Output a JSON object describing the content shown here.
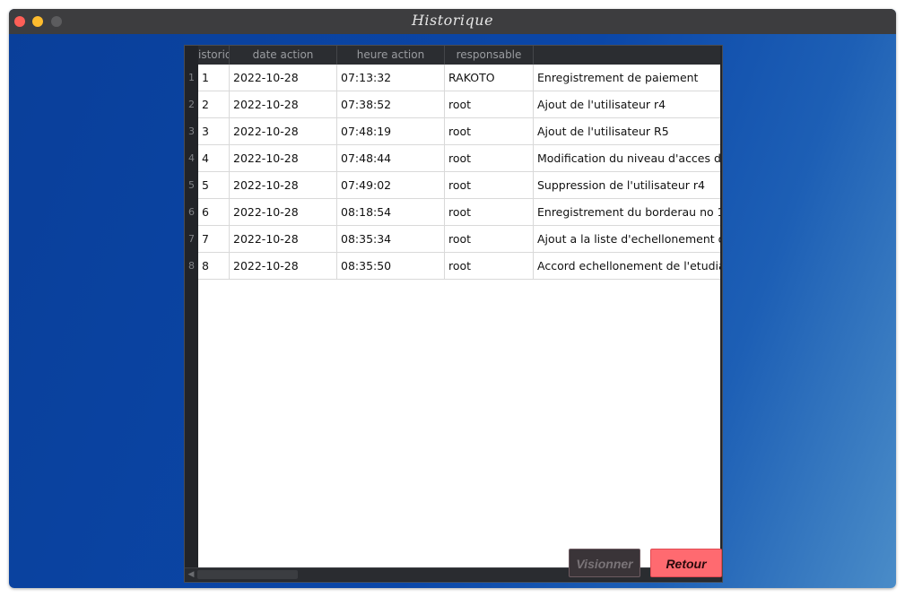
{
  "window": {
    "title": "Historique"
  },
  "table": {
    "columns": [
      "istoriq",
      "date action",
      "heure action",
      "responsable",
      ""
    ],
    "rows": [
      {
        "n": "1",
        "id": "1",
        "date": "2022-10-28",
        "time": "07:13:32",
        "user": "RAKOTO",
        "action": "Enregistrement de paiement"
      },
      {
        "n": "2",
        "id": "2",
        "date": "2022-10-28",
        "time": "07:38:52",
        "user": "root",
        "action": "Ajout de l'utilisateur r4"
      },
      {
        "n": "3",
        "id": "3",
        "date": "2022-10-28",
        "time": "07:48:19",
        "user": "root",
        "action": "Ajout de l'utilisateur R5"
      },
      {
        "n": "4",
        "id": "4",
        "date": "2022-10-28",
        "time": "07:48:44",
        "user": "root",
        "action": "Modification du niveau d'acces de"
      },
      {
        "n": "5",
        "id": "5",
        "date": "2022-10-28",
        "time": "07:49:02",
        "user": "root",
        "action": "Suppression de l'utilisateur r4"
      },
      {
        "n": "6",
        "id": "6",
        "date": "2022-10-28",
        "time": "08:18:54",
        "user": "root",
        "action": "Enregistrement du borderau no 1"
      },
      {
        "n": "7",
        "id": "7",
        "date": "2022-10-28",
        "time": "08:35:34",
        "user": "root",
        "action": "Ajout a la liste d'echellonement d"
      },
      {
        "n": "8",
        "id": "8",
        "date": "2022-10-28",
        "time": "08:35:50",
        "user": "root",
        "action": "Accord echellonement de l'etudia"
      }
    ]
  },
  "buttons": {
    "view": "Visionner",
    "back": "Retour"
  },
  "colors": {
    "back_button": "#ff6a70",
    "background": "#0b47a8"
  }
}
